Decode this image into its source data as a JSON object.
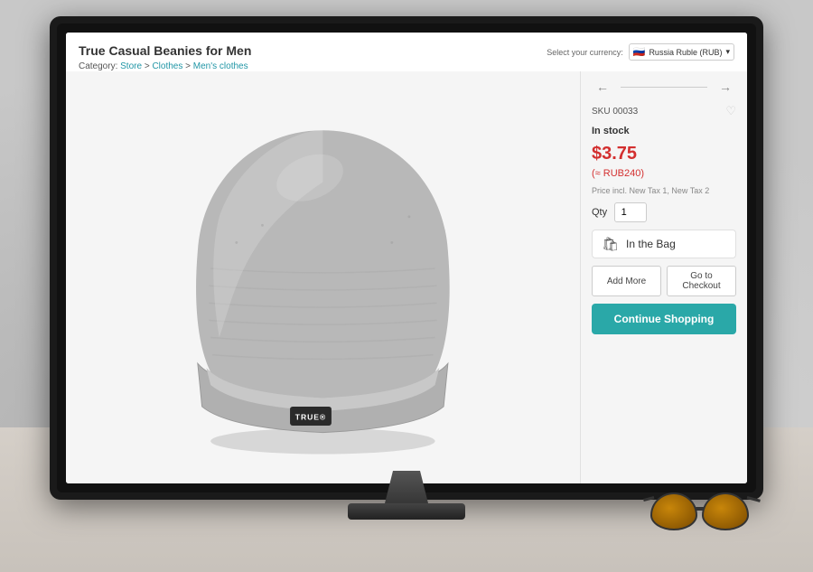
{
  "monitor": {
    "screen": {
      "product": {
        "title": "True Casual Beanies for Men",
        "breadcrumb": {
          "prefix": "Category:",
          "store": "Store",
          "clothes": "Clothes",
          "mens_clothes": "Men's clothes"
        },
        "currency": {
          "label": "Select your currency:",
          "value": "Russia Ruble (RUB)",
          "flag": "🇷🇺"
        },
        "sku": "SKU 00033",
        "in_stock": "In stock",
        "price_usd": "$3.75",
        "price_rub": "(≈ RUB240)",
        "tax_info": "Price incl. New Tax 1, New Tax 2",
        "qty_label": "Qty",
        "qty_value": "1",
        "in_bag_label": "In the Bag",
        "add_more": "Add More",
        "go_to_checkout": "Go to Checkout",
        "continue_shopping": "Continue Shopping"
      }
    }
  }
}
